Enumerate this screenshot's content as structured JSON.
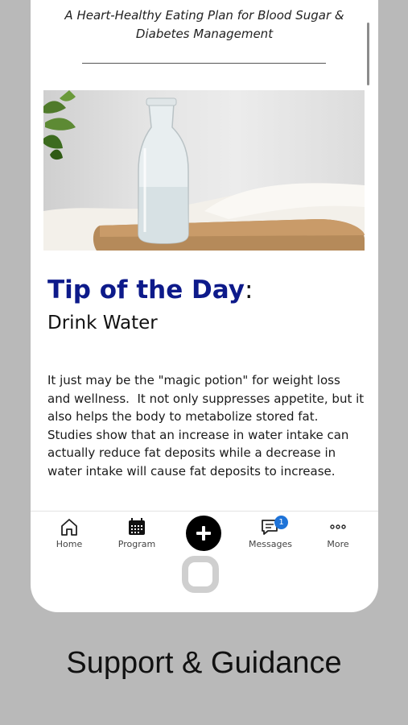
{
  "subtitle": "A Heart-Healthy Eating Plan for Blood Sugar & Diabetes Management",
  "tip": {
    "heading": "Tip of the Day",
    "colon": ":",
    "title": "Drink Water",
    "body": "It just may be the \"magic potion\" for weight loss and wellness.  It not only suppresses appetite, but it also helps the body to metabolize stored fat.  Studies show that an increase in water intake can actually reduce fat deposits while a decrease in water intake will cause fat deposits to increase."
  },
  "tabs": {
    "home": "Home",
    "program": "Program",
    "messages": "Messages",
    "messages_badge": "1",
    "more": "More"
  },
  "caption": "Support & Guidance",
  "colors": {
    "heading": "#0d1a8a",
    "badge": "#1e73d8",
    "background": "#b9b9b9"
  },
  "icons": [
    "home-icon",
    "calendar-icon",
    "plus-icon",
    "chat-icon",
    "ellipsis-icon"
  ]
}
